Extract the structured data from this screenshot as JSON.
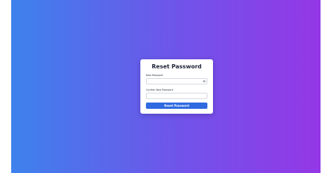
{
  "form": {
    "title": "Reset Password",
    "new_password_label": "New Password",
    "new_password_value": "",
    "confirm_password_label": "Confirm New Password",
    "confirm_password_value": "",
    "submit_label": "Reset Password",
    "toggle_icon": "eye-icon"
  },
  "colors": {
    "gradient_start": "#3d82ec",
    "gradient_end": "#9437e6",
    "button": "#2f6ae0",
    "card": "#ffffff"
  }
}
